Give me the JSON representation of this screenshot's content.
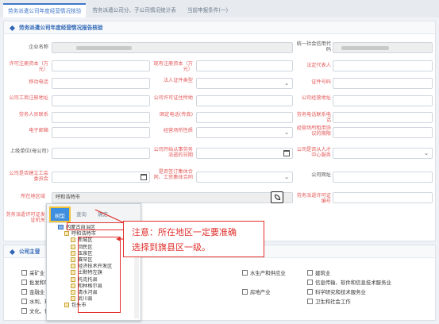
{
  "tabs": [
    {
      "label": "劳务派遣公司年度经营情况核验"
    },
    {
      "label": "劳务派遣公司分、子公司情况统计表"
    },
    {
      "label": "当前申报条件(一)"
    }
  ],
  "section1": {
    "title": "劳务派遣公司年度经营情况报告核验"
  },
  "form": {
    "company_name": "企业名称",
    "credit_code": "统一社会信用代码",
    "reg_capital": "许可注册资本（万元）",
    "cur_reg_capital": "现有注册资本（万元）",
    "legal_rep": "法定代表人",
    "mobile": "移动电话",
    "legal_id_type": "法人证件类型",
    "id_no": "证件号码",
    "biz_addr": "公司工商注册地址",
    "permit_addr": "公司许可证住所地",
    "office_addr": "公司经营地址",
    "labor_contact": "劳务人员联系",
    "phone_fax": "固定电话(传真)",
    "phone_contact": "劳务电话联系电话",
    "email": "电子邮箱",
    "biz_premise": "经营场所性质",
    "rent_period": "经营场所租用协议的期限",
    "parent": "上级单位(母公司)",
    "open_date": "公司开始从事劳务派遣的日期",
    "listed": "公司是否从人才中心服务",
    "union": "公司是否建立工会委员会",
    "has_union": "是否签订集体合同、工资集体合同",
    "website": "公司网址",
    "region": "所在地区域",
    "region_value": "呼和浩特市",
    "permit_no": "劳务派遣许可证编号",
    "permit_org": "劳务派遣许可证发证机关"
  },
  "dropdown": {
    "tabs": [
      "树型",
      "查询",
      "确定"
    ],
    "tree": [
      {
        "label": "内蒙古自治区",
        "level": 0
      },
      {
        "label": "呼和浩特市",
        "level": 1
      },
      {
        "label": "新城区",
        "level": 2
      },
      {
        "label": "回民区",
        "level": 2
      },
      {
        "label": "玉泉区",
        "level": 2
      },
      {
        "label": "赛罕区",
        "level": 2
      },
      {
        "label": "经济技术开发区",
        "level": 2
      },
      {
        "label": "土默特左旗",
        "level": 2
      },
      {
        "label": "托克托县",
        "level": 2
      },
      {
        "label": "和林格尔县",
        "level": 2
      },
      {
        "label": "清水河县",
        "level": 2
      },
      {
        "label": "武川县",
        "level": 2
      },
      {
        "label": "包头市",
        "level": 1
      }
    ]
  },
  "callout": {
    "line1": "注意：所在地区一定要准确",
    "line2": "选择到旗县区一级。"
  },
  "section2": {
    "title": "公司主营",
    "items_left": [
      "采矿业",
      "批发和零售业",
      "金融业",
      "水利、环境",
      "文化、体育"
    ],
    "items_mid": [
      "水生产和供应业",
      "房地产业"
    ],
    "items_right": [
      "建筑业",
      "信息传输、软件和信息技术服务业",
      "科学研究和技术服务业",
      "卫生和社会工作"
    ]
  },
  "colors": {
    "accent": "#3f76c9",
    "alert": "#e0302d",
    "required": "#e45b5b"
  }
}
